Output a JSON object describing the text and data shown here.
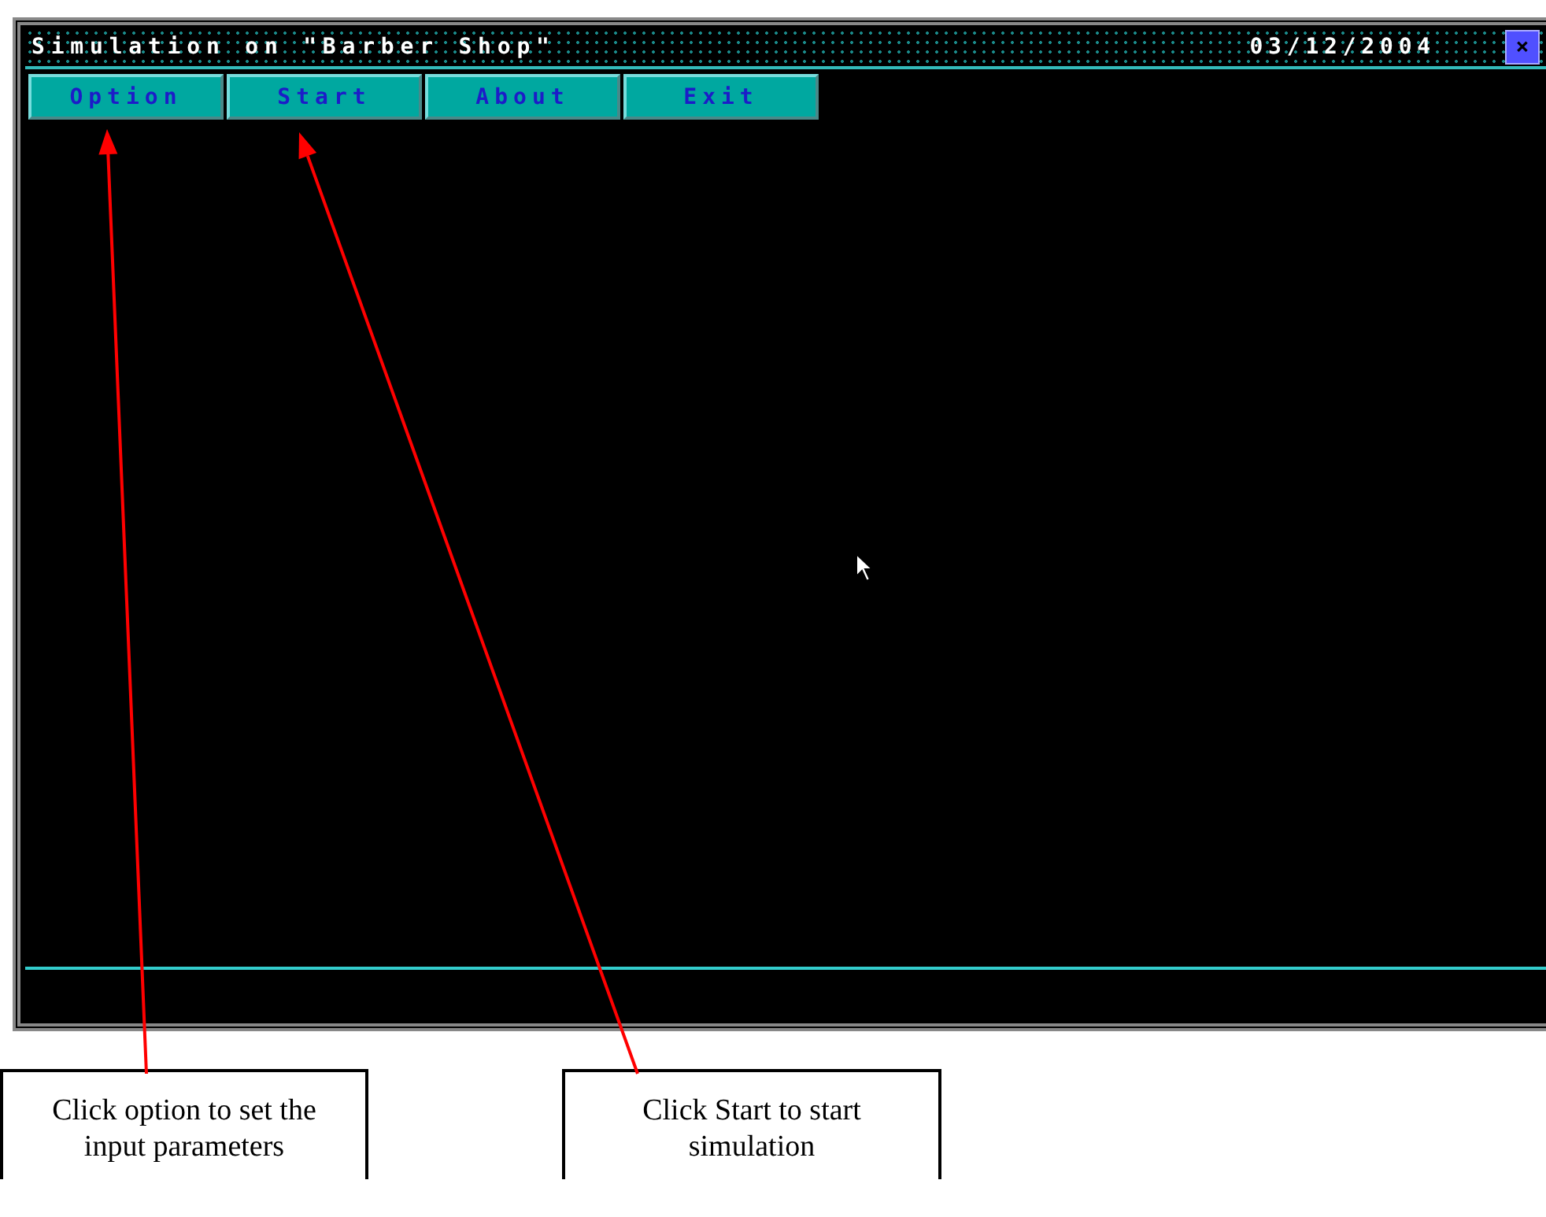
{
  "window": {
    "title": "Simulation on \"Barber Shop\"",
    "date": "03/12/2004",
    "close_button": "×"
  },
  "menu": [
    {
      "label": "Option"
    },
    {
      "label": "Start"
    },
    {
      "label": "About"
    },
    {
      "label": "Exit"
    }
  ],
  "callouts": [
    {
      "text": "Click option to set the input parameters"
    },
    {
      "text": "Click Start to start simulation"
    }
  ]
}
